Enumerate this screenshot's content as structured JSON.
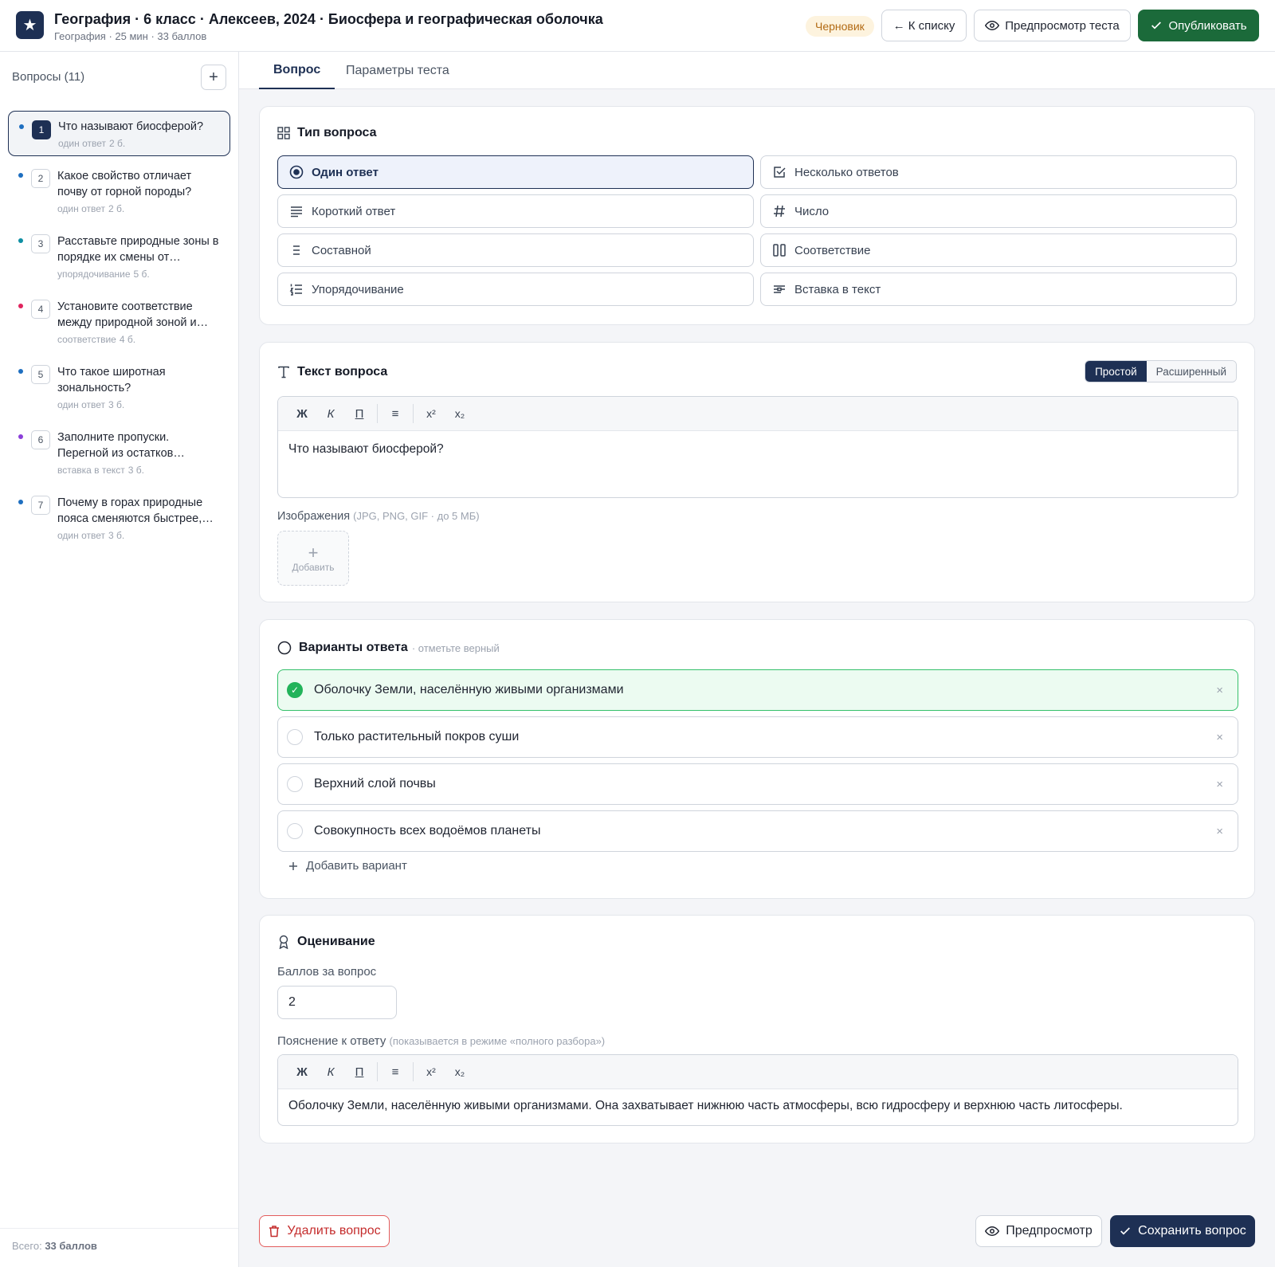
{
  "header": {
    "logo_glyph": "★",
    "title": "География · 6 класс · Алексеев, 2024 · Биосфера и географическая оболочка",
    "subtitle": "География · 25 мин · 33 баллов",
    "status_badge": "Черновик",
    "back_button": "← К списку",
    "preview_button": "Предпросмотр теста",
    "publish_button": "Опубликовать"
  },
  "sidebar": {
    "heading": "Вопросы (11)",
    "add_glyph": "+",
    "questions": [
      {
        "num": "1",
        "text": "Что называют биосферой?",
        "type": "один ответ",
        "points": "2 б.",
        "dot": "#1e6fc0"
      },
      {
        "num": "2",
        "text": "Какое свойство отличает почву от горной породы?",
        "type": "один ответ",
        "points": "2 б.",
        "dot": "#1e6fc0"
      },
      {
        "num": "3",
        "text": "Расставьте природные зоны в порядке их смены от…",
        "type": "упорядочивание",
        "points": "5 б.",
        "dot": "#0e8fa3"
      },
      {
        "num": "4",
        "text": "Установите соответствие между природной зоной и…",
        "type": "соответствие",
        "points": "4 б.",
        "dot": "#e0245e"
      },
      {
        "num": "5",
        "text": "Что такое широтная зональность?",
        "type": "один ответ",
        "points": "3 б.",
        "dot": "#1e6fc0"
      },
      {
        "num": "6",
        "text": "Заполните пропуски. Перегной из остатков…",
        "type": "вставка в текст",
        "points": "3 б.",
        "dot": "#8b3fd9"
      },
      {
        "num": "7",
        "text": "Почему в горах природные пояса сменяются быстрее,…",
        "type": "один ответ",
        "points": "3 б.",
        "dot": "#1e6fc0"
      }
    ],
    "footer_prefix": "Всего: ",
    "footer_total": "33 баллов"
  },
  "tabs": [
    "Вопрос",
    "Параметры теста"
  ],
  "question_type": {
    "title": "Тип вопроса",
    "options": [
      {
        "label": "Один ответ",
        "icon": "radio-icon",
        "selected": true
      },
      {
        "label": "Несколько ответов",
        "icon": "checkbox-icon",
        "selected": false
      },
      {
        "label": "Короткий ответ",
        "icon": "lines-icon",
        "selected": false
      },
      {
        "label": "Число",
        "icon": "hash-icon",
        "selected": false
      },
      {
        "label": "Составной",
        "icon": "list-icon",
        "selected": false
      },
      {
        "label": "Соответствие",
        "icon": "columns-icon",
        "selected": false
      },
      {
        "label": "Упорядочивание",
        "icon": "ordered-list-icon",
        "selected": false
      },
      {
        "label": "Вставка в текст",
        "icon": "text-insert-icon",
        "selected": false
      }
    ]
  },
  "question_text": {
    "title": "Текст вопроса",
    "mode_simple": "Простой",
    "mode_advanced": "Расширенный",
    "toolbar": {
      "bold": "Ж",
      "italic": "К",
      "underline": "П",
      "list": "≡",
      "sup": "x²",
      "sub": "x₂"
    },
    "content": "Что называют биосферой?",
    "images_label": "Изображения",
    "images_hint": "(JPG, PNG, GIF · до 5 МБ)",
    "add_image_plus": "+",
    "add_image": "Добавить"
  },
  "answers": {
    "title": "Варианты ответа",
    "hint": "· отметьте верный",
    "check_glyph": "✓",
    "remove_glyph": "×",
    "options": [
      {
        "text": "Оболочку Земли, населённую живыми организмами",
        "correct": true
      },
      {
        "text": "Только растительный покров суши",
        "correct": false
      },
      {
        "text": "Верхний слой почвы",
        "correct": false
      },
      {
        "text": "Совокупность всех водоёмов планеты",
        "correct": false
      }
    ],
    "add_option": "Добавить вариант"
  },
  "grading": {
    "title": "Оценивание",
    "points_label": "Баллов за вопрос",
    "points_value": "2",
    "explanation_label": "Пояснение к ответу",
    "explanation_hint": "(показывается в режиме «полного разбора»)",
    "explanation_text": "Оболочку Земли, населённую живыми организмами. Она захватывает нижнюю часть атмосферы, всю гидросферу и верхнюю часть литосферы."
  },
  "footer": {
    "delete_button": "Удалить вопрос",
    "preview_button": "Предпросмотр",
    "save_button": "Сохранить вопрос"
  },
  "colors": {
    "brand": "#1e3054",
    "publish": "#1b6a3a",
    "correct": "#22b35a",
    "danger": "#dc2626"
  }
}
